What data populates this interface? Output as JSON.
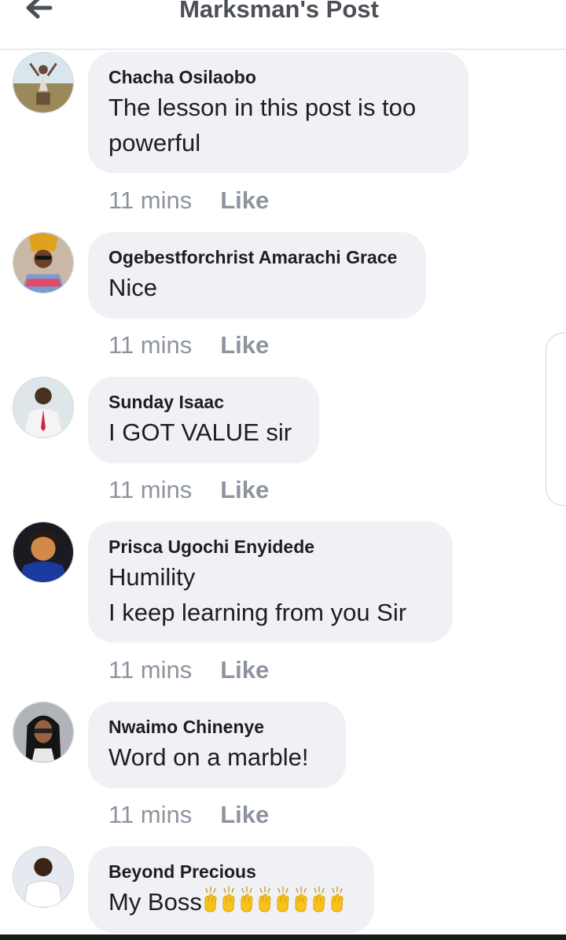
{
  "header": {
    "title": "Marksman's Post",
    "back_icon": "arrow-left-icon"
  },
  "comments": [
    {
      "author": "Chacha Osilaobo",
      "text": "The lesson in this post is too\npowerful",
      "time": "11 mins",
      "like": "Like"
    },
    {
      "author": "Ogebestforchrist Amarachi Grace",
      "text": "Nice",
      "time": "11 mins",
      "like": "Like"
    },
    {
      "author": "Sunday Isaac",
      "text": "I GOT VALUE sir",
      "time": "11 mins",
      "like": "Like"
    },
    {
      "author": "Prisca Ugochi Enyidede",
      "text": "Humility\nI keep learning from you Sir",
      "time": "11 mins",
      "like": "Like"
    },
    {
      "author": "Nwaimo Chinenye",
      "text": "Word on a marble!",
      "time": "11 mins",
      "like": "Like"
    },
    {
      "author": "Beyond Precious",
      "text": "My Boss",
      "emoji": "clapping-hands-icon",
      "time": "",
      "like": ""
    }
  ],
  "colors": {
    "bubble": "#f0f1f4",
    "meta": "#8d949e",
    "title": "#4b4f56"
  }
}
